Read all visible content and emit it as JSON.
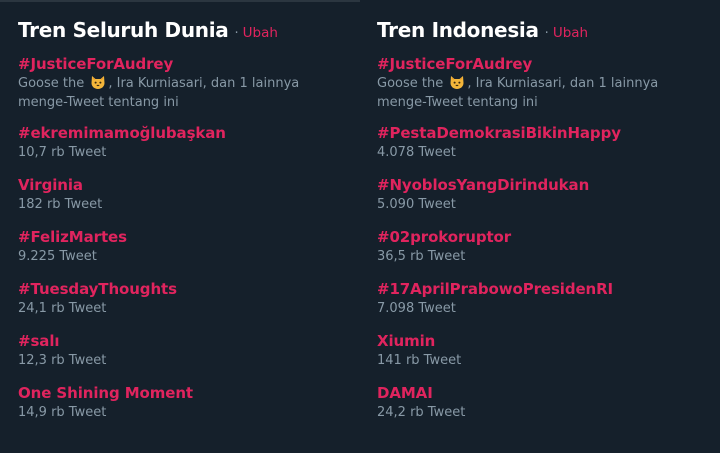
{
  "left": {
    "title": "Tren Seluruh Dunia",
    "separator": "·",
    "change_label": "Ubah",
    "trends": [
      {
        "name": "#JusticeForAudrey",
        "context_prefix": "Goose the",
        "context_suffix": ", Ira Kurniasari, dan 1 lainnya",
        "context_line2": "menge-Tweet tentang ini"
      },
      {
        "name": "#ekremimamoğlubaşkan",
        "count": "10,7 rb Tweet"
      },
      {
        "name": "Virginia",
        "count": "182 rb Tweet"
      },
      {
        "name": "#FelizMartes",
        "count": "9.225 Tweet"
      },
      {
        "name": "#TuesdayThoughts",
        "count": "24,1 rb Tweet"
      },
      {
        "name": "#salı",
        "count": "12,3 rb Tweet"
      },
      {
        "name": "One Shining Moment",
        "count": "14,9 rb Tweet"
      }
    ]
  },
  "right": {
    "title": "Tren Indonesia",
    "separator": "·",
    "change_label": "Ubah",
    "trends": [
      {
        "name": "#JusticeForAudrey",
        "context_prefix": "Goose the",
        "context_suffix": ", Ira Kurniasari, dan 1 lainnya",
        "context_line2": "menge-Tweet tentang ini"
      },
      {
        "name": "#PestaDemokrasiBikinHappy",
        "count": "4.078 Tweet"
      },
      {
        "name": "#NyoblosYangDirindukan",
        "count": "5.090 Tweet"
      },
      {
        "name": "#02prokoruptor",
        "count": "36,5 rb Tweet"
      },
      {
        "name": "#17AprilPrabowoPresidenRI",
        "count": "7.098 Tweet"
      },
      {
        "name": "Xiumin",
        "count": "141 rb Tweet"
      },
      {
        "name": "DAMAI",
        "count": "24,2 rb Tweet"
      }
    ]
  },
  "colors": {
    "background": "#15202b",
    "accent": "#e0245e",
    "muted": "#8899a6",
    "title": "#ffffff"
  }
}
